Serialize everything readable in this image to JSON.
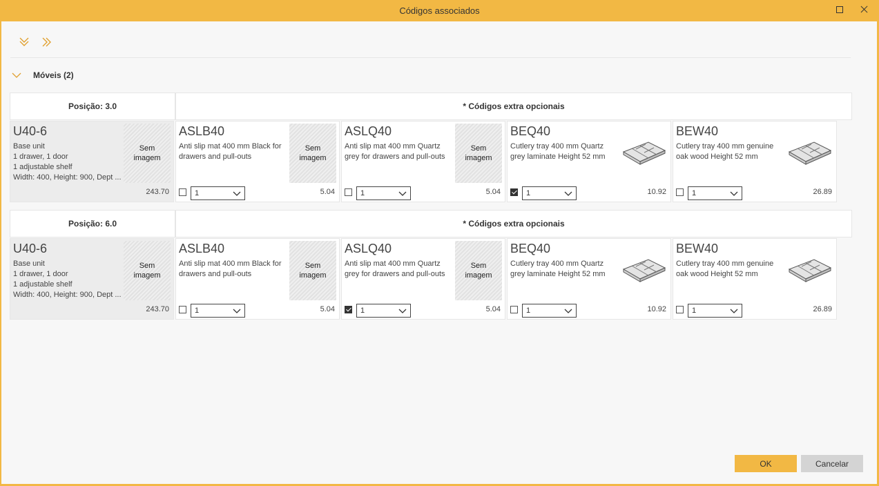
{
  "window": {
    "title": "Códigos associados"
  },
  "toolbar": {
    "expand_all_icon": "double-chevron-down-icon",
    "collapse_all_icon": "double-chevron-right-icon"
  },
  "group": {
    "title": "Móveis (2)"
  },
  "sections": [
    {
      "position_label": "Posição: 3.0",
      "extra_label": "* Códigos extra opcionais",
      "main": {
        "code": "U40-6",
        "desc": "Base unit\n1 drawer, 1 door\n1 adjustable shelf\nWidth: 400, Height: 900, Dept ...",
        "price": "243.70",
        "image_text": "Sem\nimagem"
      },
      "extras": [
        {
          "code": "ASLB40",
          "desc": "Anti slip mat  400 mm  Black  for drawers and pull-outs",
          "price": "5.04",
          "checked": false,
          "qty": "1",
          "image": "none",
          "image_text": "Sem\nimagem"
        },
        {
          "code": "ASLQ40",
          "desc": "Anti slip mat  400 mm  Quartz grey  for drawers and pull-outs",
          "price": "5.04",
          "checked": false,
          "qty": "1",
          "image": "none",
          "image_text": "Sem\nimagem"
        },
        {
          "code": "BEQ40",
          "desc": "Cutlery tray  400 mm  Quartz grey laminate  Height 52 mm",
          "price": "10.92",
          "checked": true,
          "qty": "1",
          "image": "cutlery-tray"
        },
        {
          "code": "BEW40",
          "desc": "Cutlery tray  400 mm  genuine oak wood  Height 52 mm",
          "price": "26.89",
          "checked": false,
          "qty": "1",
          "image": "cutlery-tray"
        }
      ]
    },
    {
      "position_label": "Posição: 6.0",
      "extra_label": "* Códigos extra opcionais",
      "main": {
        "code": "U40-6",
        "desc": "Base unit\n1 drawer, 1 door\n1 adjustable shelf\nWidth: 400, Height: 900, Dept ...",
        "price": "243.70",
        "image_text": "Sem\nimagem"
      },
      "extras": [
        {
          "code": "ASLB40",
          "desc": "Anti slip mat  400 mm  Black  for drawers and pull-outs",
          "price": "5.04",
          "checked": false,
          "qty": "1",
          "image": "none",
          "image_text": "Sem\nimagem"
        },
        {
          "code": "ASLQ40",
          "desc": "Anti slip mat  400 mm  Quartz grey  for drawers and pull-outs",
          "price": "5.04",
          "checked": true,
          "qty": "1",
          "image": "none",
          "image_text": "Sem\nimagem"
        },
        {
          "code": "BEQ40",
          "desc": "Cutlery tray  400 mm  Quartz grey laminate  Height 52 mm",
          "price": "10.92",
          "checked": false,
          "qty": "1",
          "image": "cutlery-tray"
        },
        {
          "code": "BEW40",
          "desc": "Cutlery tray  400 mm  genuine oak wood  Height 52 mm",
          "price": "26.89",
          "checked": false,
          "qty": "1",
          "image": "cutlery-tray"
        }
      ]
    }
  ],
  "footer": {
    "ok_label": "OK",
    "cancel_label": "Cancelar"
  },
  "colors": {
    "accent": "#f2b844",
    "cancel": "#d4d4d4"
  }
}
